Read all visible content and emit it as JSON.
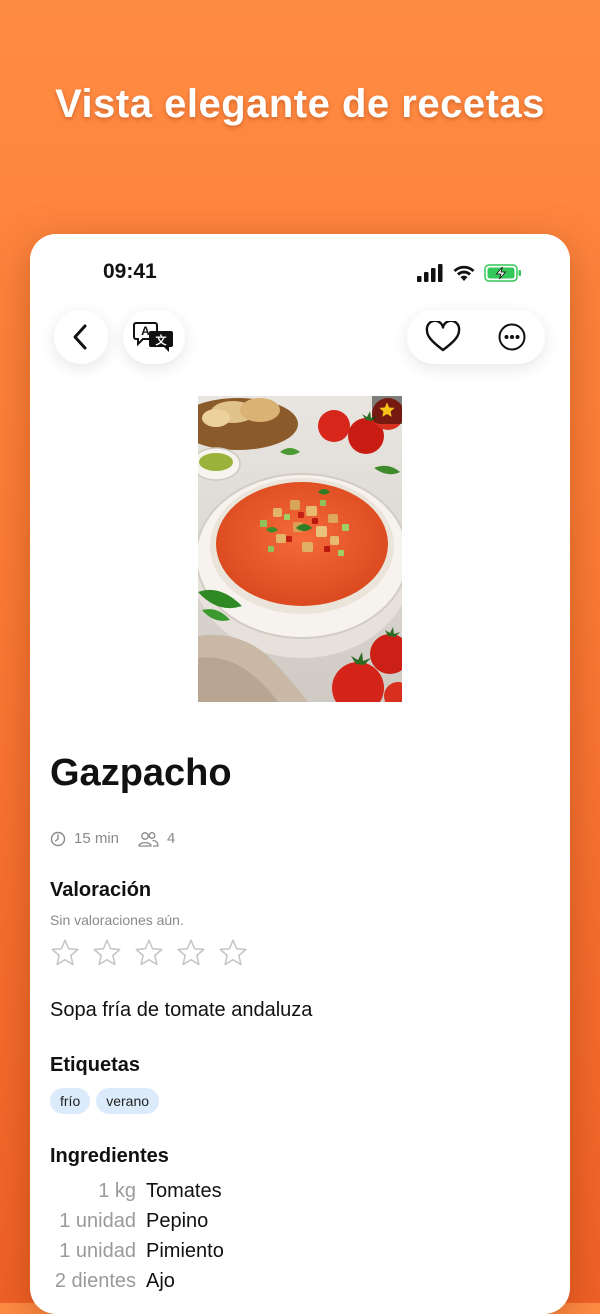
{
  "headline": "Vista elegante de recetas",
  "status": {
    "time": "09:41",
    "battery_color": "#34c759"
  },
  "recipe": {
    "title": "Gazpacho",
    "time": "15 min",
    "servings": "4",
    "rating_heading": "Valoración",
    "rating_note": "Sin valoraciones aún.",
    "rating_value": 0,
    "rating_max": 5,
    "favorite": true,
    "description": "Sopa fría de tomate andaluza",
    "tags_heading": "Etiquetas",
    "tags": [
      "frío",
      "verano"
    ],
    "ingredients_heading": "Ingredientes",
    "ingredients": [
      {
        "qty": "1 kg",
        "name": "Tomates"
      },
      {
        "qty": "1 unidad",
        "name": "Pepino"
      },
      {
        "qty": "1 unidad",
        "name": "Pimiento"
      },
      {
        "qty": "2 dientes",
        "name": "Ajo"
      }
    ]
  },
  "icons": {
    "back": "chevron-left-icon",
    "translate": "translate-icon",
    "favorite": "heart-icon",
    "more": "ellipsis-circle-icon",
    "clock": "clock-icon",
    "people": "people-icon",
    "star": "star-icon"
  },
  "colors": {
    "accent": "#fb7a35",
    "tag_bg": "#dcebfb",
    "star_badge": "#f5c518"
  }
}
